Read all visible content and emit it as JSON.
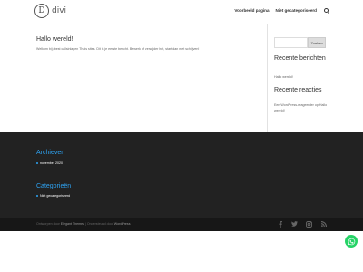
{
  "header": {
    "logo_letter": "D",
    "logo_text": "divi",
    "nav": [
      "Voorbeeld pagina",
      "Niet gecategoriseerd"
    ]
  },
  "post": {
    "title": "Hallo wereld!",
    "text": "Welkom bij (best callsinlagen Thuis sites. Dit is je eerste bericht. Bewerk of verwijder het, start dan met schrijven!"
  },
  "sidebar": {
    "search_button": "Zoeken",
    "recent_posts_title": "Recente berichten",
    "recent_posts": [
      "Hallo wereld!"
    ],
    "recent_comments_title": "Recente reacties",
    "recent_comment": "Een WordPress-reageerder op Hallo wereld!"
  },
  "footer": {
    "archives_title": "Archieven",
    "archives": [
      "november 2020"
    ],
    "categories_title": "Categorieën",
    "categories": [
      "Niet gecategoriseerd"
    ]
  },
  "bottom_bar": {
    "credits_prefix": "Ontworpen door",
    "credits_theme": "Elegant Themes",
    "credits_mid": "| Ondersteund door",
    "credits_wp": "WordPress"
  },
  "icons": [
    "facebook-icon",
    "twitter-icon",
    "instagram-icon",
    "rss-icon",
    "whatsapp-icon",
    "search-icon"
  ],
  "colors": {
    "accent": "#2ea3f2",
    "footer_bg": "#222222",
    "bottom_bg": "#171717",
    "whatsapp": "#25d366"
  }
}
